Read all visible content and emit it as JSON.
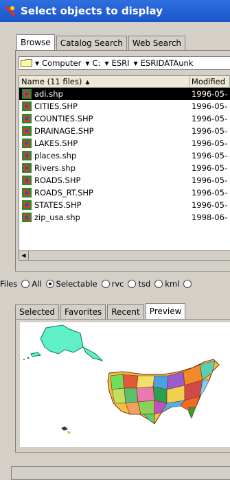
{
  "window": {
    "title": "Select objects to display"
  },
  "tabs": [
    "Browse",
    "Catalog Search",
    "Web Search"
  ],
  "path": {
    "segments": [
      "Computer",
      "C:",
      "ESRI",
      "ESRIDATAunk"
    ]
  },
  "file_list": {
    "columns": {
      "name": "Name (11 files)",
      "modified": "Modified"
    },
    "rows": [
      {
        "name": "adi.shp",
        "modified": "1996-05-"
      },
      {
        "name": "CITIES.SHP",
        "modified": "1996-05-"
      },
      {
        "name": "COUNTIES.SHP",
        "modified": "1996-05-"
      },
      {
        "name": "DRAINAGE.SHP",
        "modified": "1996-05-"
      },
      {
        "name": "LAKES.SHP",
        "modified": "1996-05-"
      },
      {
        "name": "places.shp",
        "modified": "1996-05-"
      },
      {
        "name": "Rivers.shp",
        "modified": "1996-05-"
      },
      {
        "name": "ROADS.SHP",
        "modified": "1996-05-"
      },
      {
        "name": "ROADS_RT.SHP",
        "modified": "1996-05-"
      },
      {
        "name": "STATES.SHP",
        "modified": "1996-05-"
      },
      {
        "name": "zip_usa.shp",
        "modified": "1998-06-"
      }
    ],
    "selected_row": "adi.shp"
  },
  "files_filter": {
    "label": "Files",
    "options": [
      "All",
      "Selectable",
      "rvc",
      "tsd",
      "kml"
    ],
    "selected": "Selectable"
  },
  "bottom_tabs": [
    "Selected",
    "Favorites",
    "Recent",
    "Preview"
  ],
  "active_bottom_tab": "Preview",
  "colors": {
    "titlebar": "#1b56c9",
    "selection": "#000000",
    "preview_accent": "#5ff0c8"
  }
}
